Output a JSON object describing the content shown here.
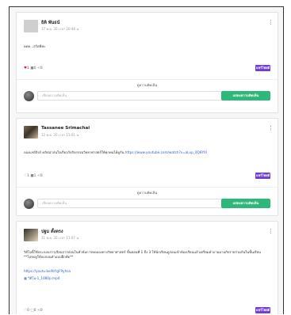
{
  "posts": [
    {
      "author": "ธิติ พันธน์",
      "time": "17 พ.ค. 20 เวลา 20:48 น.",
      "body": "ดดด...สวัสดีค่ะ",
      "stats": {
        "likes": "1",
        "comments": "0",
        "shares": "0"
      },
      "share_label": "แชร์โพสต์",
      "comments_title": "ดูความคิดเห็น",
      "comment_placeholder": "เขียนความคิดเห็น",
      "comment_button": "แสดงความคิดเห็น"
    },
    {
      "author": "Tassanee Srimachai",
      "time": "12 พ.ค. 20 เวลา 13:01 น.",
      "body": "ลองแชร์ลิงก์ คลิปน่าสนใจเกี่ยวกับกิจกรรมวิทยาศาสตร์ให้ทุกคนได้ดูกัน ",
      "link": "https://www.youtube.com/watch?v=aLvp_0Q8Y0I",
      "stats": {
        "likes": "1",
        "comments": "1",
        "shares": "0"
      },
      "share_label": "แชร์โพสต์",
      "comments_title": "ดูความคิดเห็น",
      "comment_placeholder": "เขียนความคิดเห็น",
      "comment_button": "แสดงความคิดเห็น"
    },
    {
      "author": "ปฐม ตั้งตรง",
      "time": "11 พ.ค. 20 เวลา 11:07 น.",
      "body": "วิดีโอนี้ใช้ประกอบการเรียนการสอนในหัวข้อการทดลองทางวิทยาศาสตร์ ขั้นตอนที่ 1 ถึง 3 ให้นักเรียนดูก่อนเข้าห้องเรียนแล้วเตรียมคำถามมาอภิปรายร่วมกันในชั้นเรียน **โปรดดูให้จบก่อนทำแบบฝึกหัด**",
      "link": "https://youtu.be/IbYgF9yhsa",
      "file": "วิดีโอ-1_1080p.mp4",
      "stats": {
        "likes": "0",
        "comments": "0",
        "shares": "0"
      },
      "share_label": "แชร์โพสต์"
    }
  ],
  "colors": {
    "accent": "#6f3fd1",
    "comment_button": "#2db87a",
    "link": "#2a63c7",
    "like": "#d22222"
  }
}
